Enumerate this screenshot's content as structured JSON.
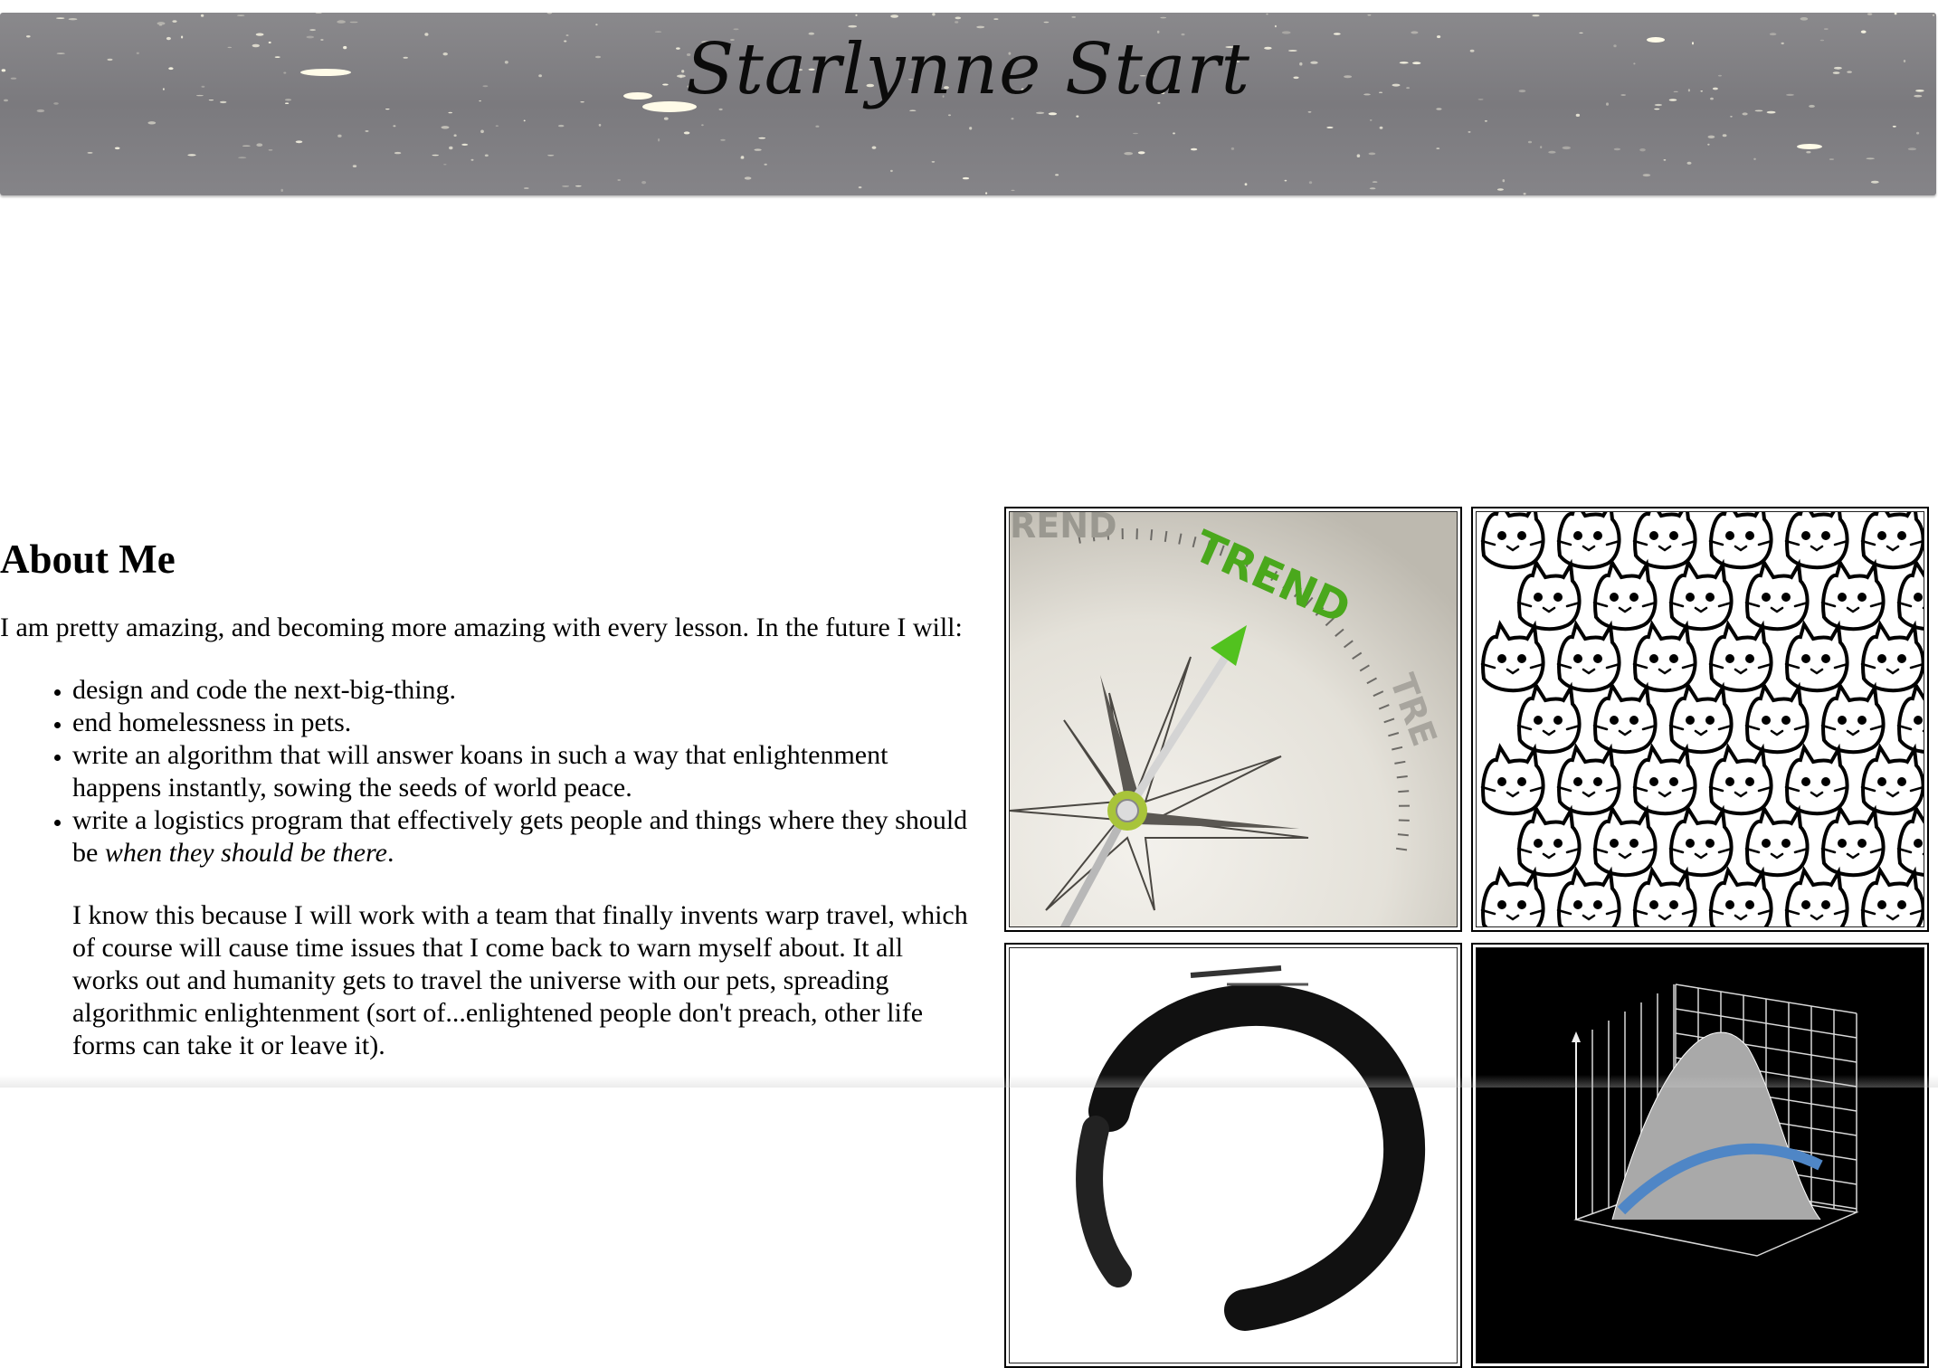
{
  "header": {
    "site_title": "Starlynne Start",
    "banner_image": "starfield-banner"
  },
  "about": {
    "heading": "About Me",
    "intro": "I am pretty amazing, and becoming more amazing with every lesson. In the future I will:",
    "goals": [
      "design and code the next-big-thing.",
      "end homelessness in pets.",
      "write an algorithm that will answer koans in such a way that enlightenment happens instantly, sowing the seeds of world peace.",
      "write a logistics program that effectively gets people and things where they should be "
    ],
    "goal_4_emphasis": "when they should be there",
    "goal_4_end": ".",
    "warp_paragraph": "I know this because I will work with a team that finally invents warp travel, which of course will cause time issues that I come back to warn myself about. It all works out and humanity gets to travel the universe with our pets, spreading algorithmic enlightenment (sort of...enlightened people don't preach, other life forms can take it or leave it)."
  },
  "gallery": {
    "images": [
      {
        "name": "trend-compass-image",
        "text": "TREND",
        "faded_left": "REND",
        "faded_right": "TRE"
      },
      {
        "name": "cat-doodles-image"
      },
      {
        "name": "enso-circle-image"
      },
      {
        "name": "3d-surface-plot-image"
      }
    ]
  },
  "colors": {
    "banner": "#7f7e82",
    "trend_green": "#4aa81c",
    "compass_bg": "#e6e3dc"
  }
}
